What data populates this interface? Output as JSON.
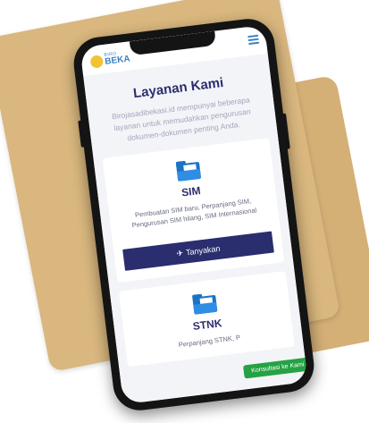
{
  "header": {
    "logo_small": "BIRO",
    "logo_big": "BEKA"
  },
  "main": {
    "title": "Layanan Kami",
    "intro": "Birojasadibekasi.id mempunyai beberapa layanan untuk memudahkan pengurusan dokumen-dokumen penting Anda."
  },
  "services": [
    {
      "title": "SIM",
      "description": "Pembuatan SIM baru, Perpanjang SIM, Pengurusan SIM hilang, SIM Internasional",
      "button_label": "Tanyakan",
      "icon": "folder-icon"
    },
    {
      "title": "STNK",
      "description": "Perpanjang STNK, P",
      "icon": "folder-icon"
    }
  ],
  "floating": {
    "whatsapp_label": "Konsultasi ke Kami"
  },
  "colors": {
    "accent": "#2a2d6e",
    "title": "#2d2e6b",
    "icon_blue": "#1a73c6",
    "whatsapp_green": "#25a244",
    "paper": "#d9b77e"
  }
}
